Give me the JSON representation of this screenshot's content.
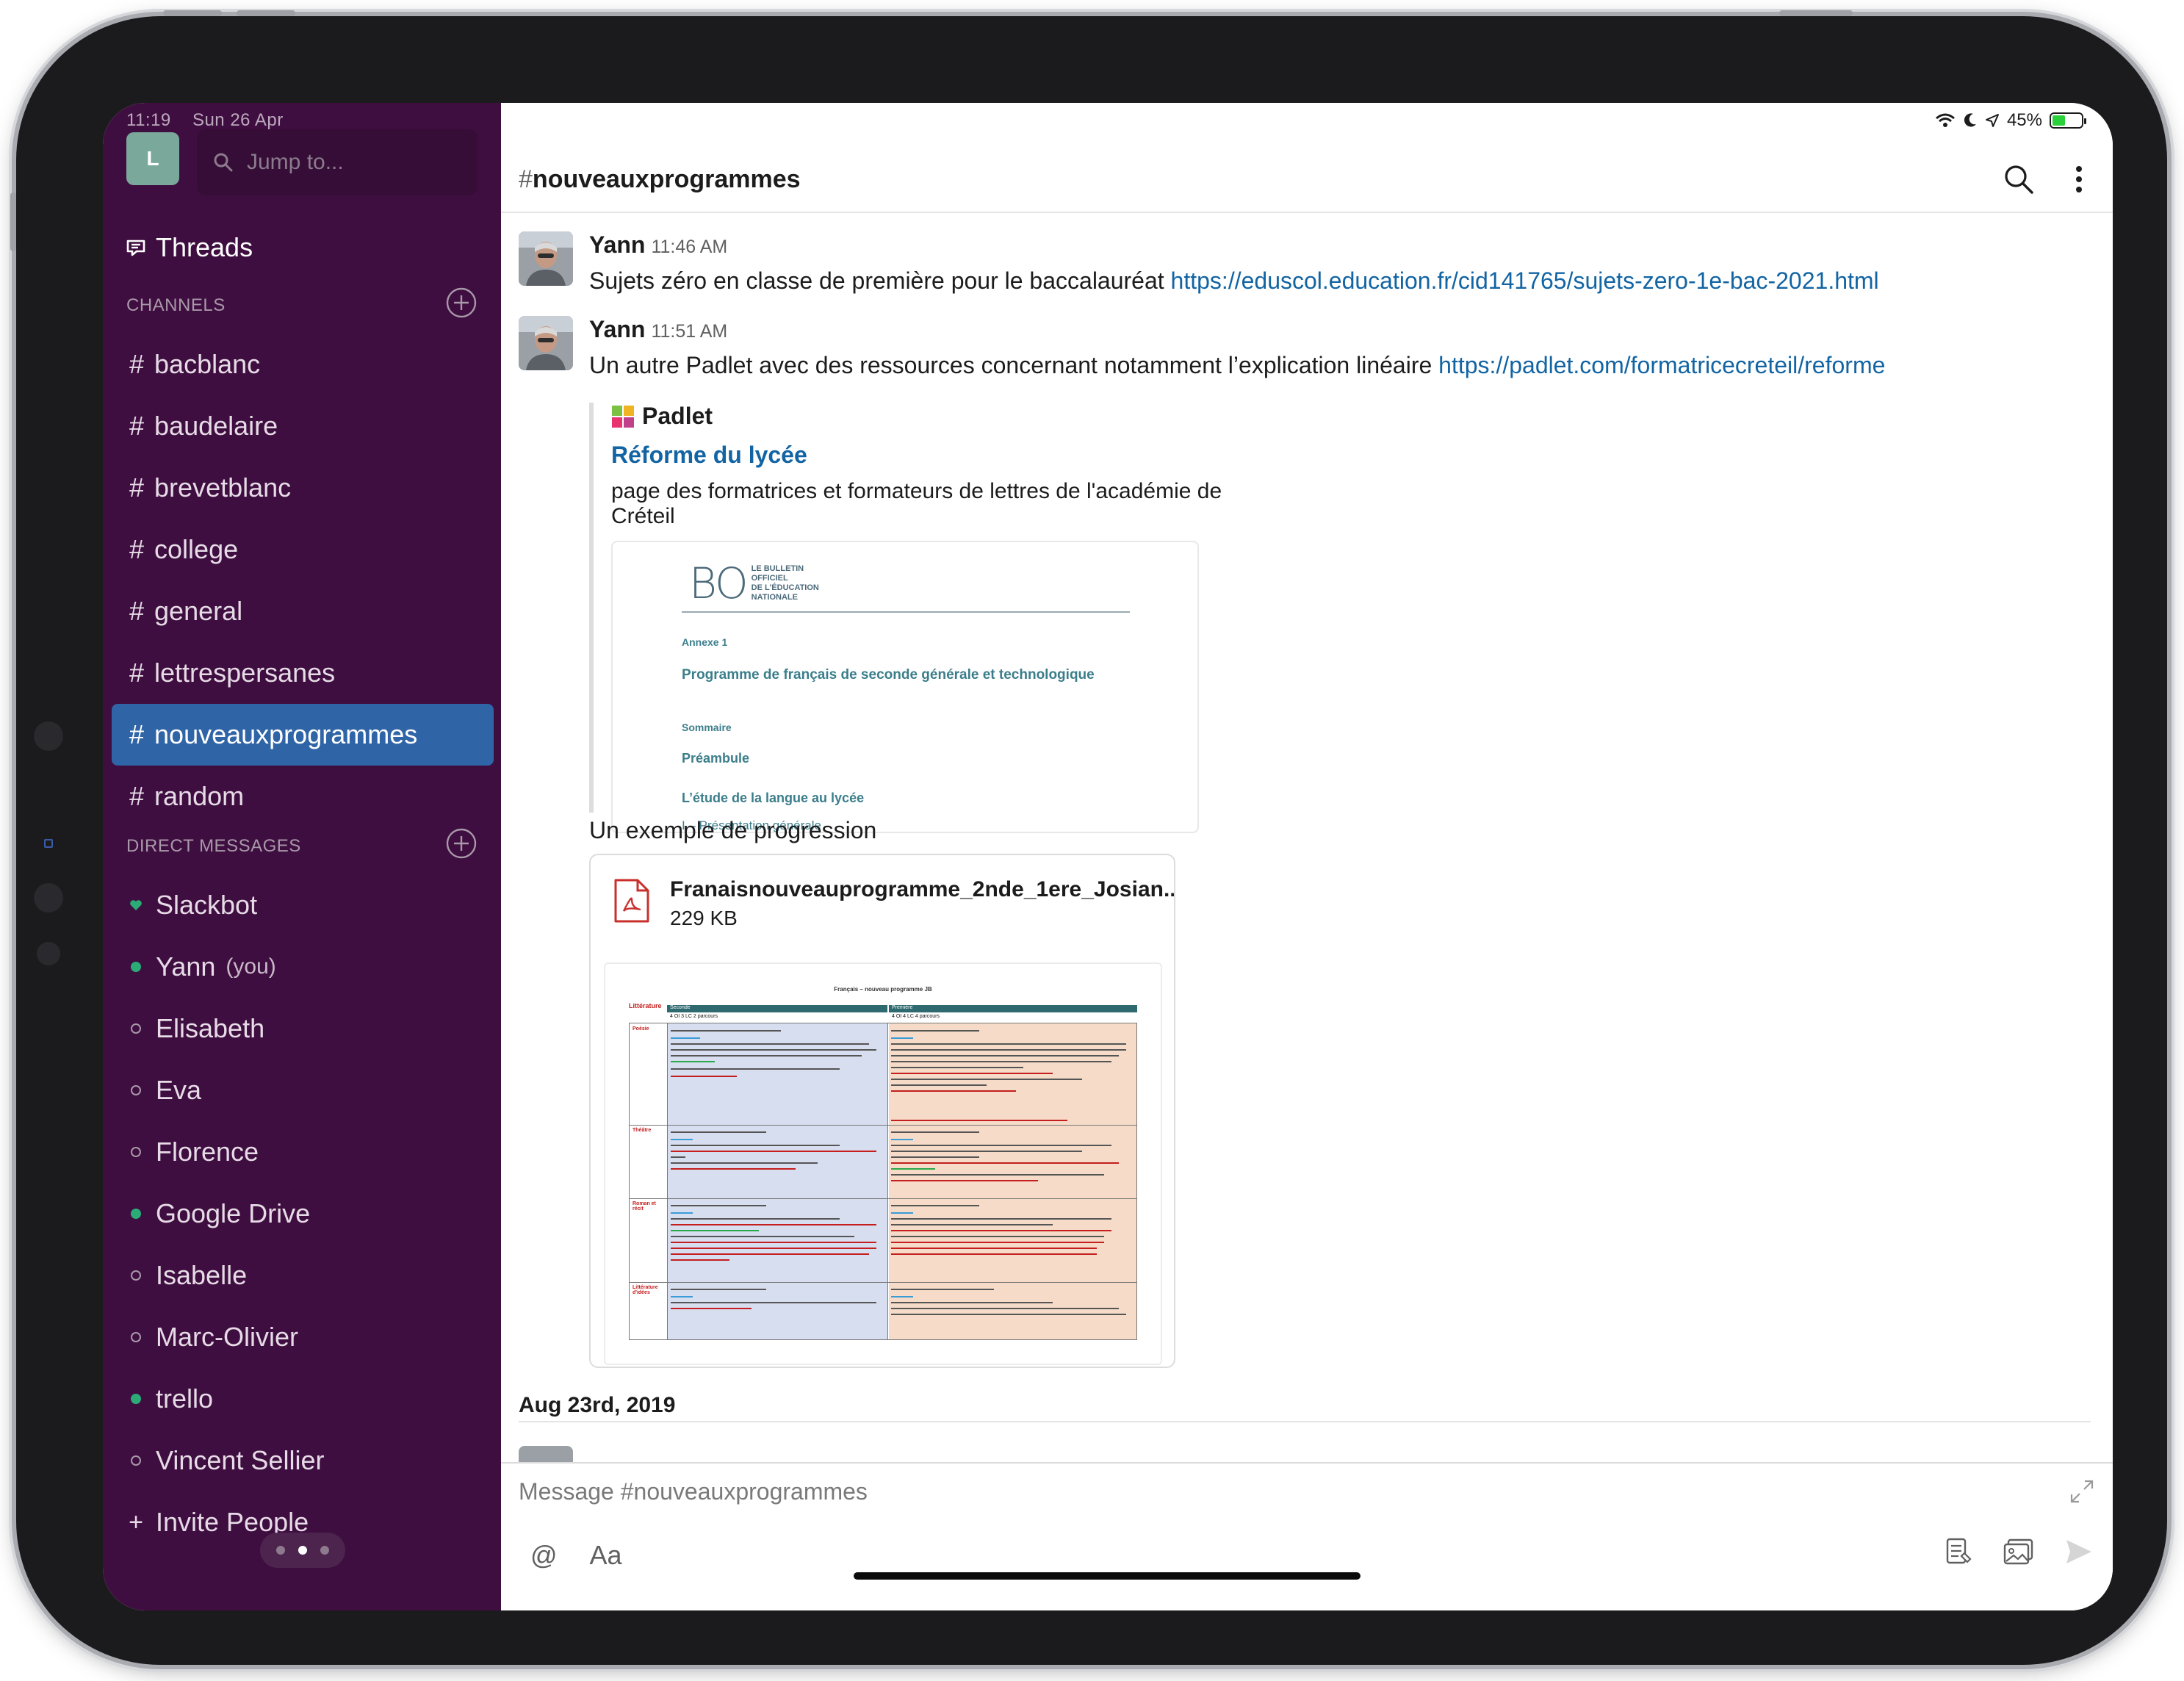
{
  "status_bar": {
    "time": "11:19",
    "date": "Sun 26 Apr",
    "battery": "45%"
  },
  "workspace": {
    "initial": "L"
  },
  "search": {
    "placeholder": "Jump to..."
  },
  "nav": {
    "threads": "Threads"
  },
  "sections": {
    "channels": "CHANNELS",
    "direct_messages": "DIRECT MESSAGES"
  },
  "channels": [
    {
      "name": "bacblanc",
      "active": false
    },
    {
      "name": "baudelaire",
      "active": false
    },
    {
      "name": "brevetblanc",
      "active": false
    },
    {
      "name": "college",
      "active": false
    },
    {
      "name": "general",
      "active": false
    },
    {
      "name": "lettrespersanes",
      "active": false
    },
    {
      "name": "nouveauxprogrammes",
      "active": true
    },
    {
      "name": "random",
      "active": false
    }
  ],
  "direct_messages": [
    {
      "name": "Slackbot",
      "status": "heart"
    },
    {
      "name": "Yann",
      "suffix": "(you)",
      "status": "online"
    },
    {
      "name": "Elisabeth",
      "status": "away"
    },
    {
      "name": "Eva",
      "status": "away"
    },
    {
      "name": "Florence",
      "status": "away"
    },
    {
      "name": "Google Drive",
      "status": "online"
    },
    {
      "name": "Isabelle",
      "status": "away"
    },
    {
      "name": "Marc-Olivier",
      "status": "away"
    },
    {
      "name": "trello",
      "status": "online"
    },
    {
      "name": "Vincent Sellier",
      "status": "away"
    }
  ],
  "invite": "Invite People",
  "channel_header": {
    "hash": "#",
    "name": "nouveauxprogrammes"
  },
  "messages": [
    {
      "author": "Yann",
      "time": "11:46 AM",
      "text": "Sujets zéro en classe de première pour le baccalauréat ",
      "link": "https://eduscol.education.fr/cid141765/sujets-zero-1e-bac-2021.html"
    },
    {
      "author": "Yann",
      "time": "11:51 AM",
      "text": "Un autre Padlet avec des ressources concernant notamment l’explication linéaire ",
      "link": "https://padlet.com/formatricecreteil/reforme",
      "unfurl": {
        "source": "Padlet",
        "title": "Réforme du lycée",
        "description": "page des formatrices et formateurs de lettres de l'académie de Créteil",
        "preview": {
          "logo": "BO",
          "logo_text": [
            "LE BULLETIN",
            "OFFICIEL",
            "DE L'ÉDUCATION",
            "NATIONALE"
          ],
          "annex": "Annexe 1",
          "heading": "Programme de français de seconde générale et technologique",
          "toc_label": "Sommaire",
          "item1": "Préambule",
          "item2": "L’étude de la langue au lycée",
          "item3": "I – Présentation générale"
        }
      }
    }
  ],
  "followup_text": "Un exemple de progression",
  "file": {
    "name": "Franaisnouveauprogramme_2nde_1ere_Josian...",
    "size": "229 KB",
    "preview_title": "Français – nouveau programme JB",
    "columns": [
      "Littérature",
      "Seconde",
      "Première"
    ],
    "subcolumns": [
      "4 OI 3 LC 2 parcours",
      "4 OI 4 LC 4 parcours"
    ],
    "rows": [
      "Poésie",
      "Théâtre",
      "Roman et récit",
      "Littérature d'idées"
    ]
  },
  "date_divider": "Aug 23rd, 2019",
  "composer": {
    "placeholder": "Message #nouveauxprogrammes",
    "at": "@",
    "format": "Aa"
  },
  "colors": {
    "sidebar": "#3f0e40",
    "active_channel": "#2f64a6",
    "link": "#1264a3",
    "online": "#2bac76"
  }
}
